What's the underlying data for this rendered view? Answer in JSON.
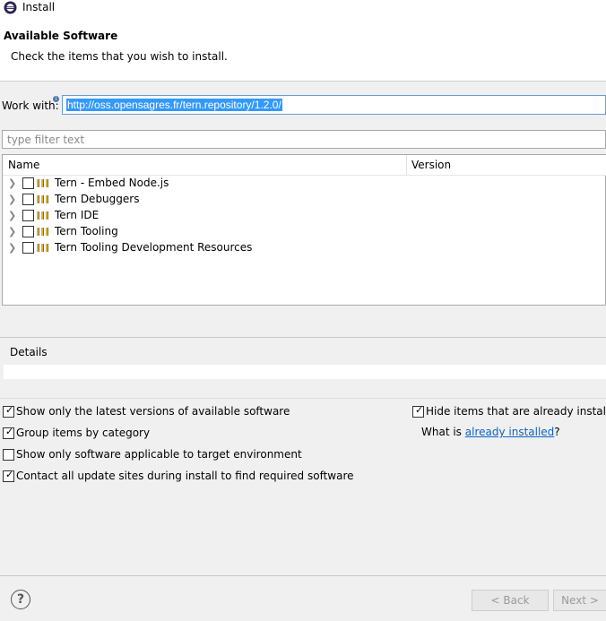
{
  "window": {
    "title": "Install",
    "icon": "eclipse-icon"
  },
  "header": {
    "title": "Available Software",
    "description": "Check the items that you wish to install."
  },
  "work_with": {
    "label": "Work with:",
    "value": "http://oss.opensagres.fr/tern.repository/1.2.0/",
    "info_icon": "info-icon"
  },
  "filter": {
    "placeholder": "type filter text"
  },
  "tree": {
    "columns": [
      "Name",
      "Version"
    ],
    "items": [
      {
        "label": "Tern - Embed Node.js",
        "checked": false
      },
      {
        "label": "Tern Debuggers",
        "checked": false
      },
      {
        "label": "Tern IDE",
        "checked": false
      },
      {
        "label": "Tern Tooling",
        "checked": false
      },
      {
        "label": "Tern Tooling Development Resources",
        "checked": false
      }
    ]
  },
  "details": {
    "label": "Details"
  },
  "options": {
    "latest_versions": {
      "label": "Show only the latest versions of available software",
      "checked": true
    },
    "group_by_category": {
      "label": "Group items by category",
      "checked": true
    },
    "target_env": {
      "label": "Show only software applicable to target environment",
      "checked": false
    },
    "contact_sites": {
      "label": "Contact all update sites during install to find required software",
      "checked": true
    },
    "hide_installed": {
      "label": "Hide items that are already installed",
      "checked": true
    },
    "what_is_prefix": "What is ",
    "what_is_link": "already installed",
    "what_is_suffix": "?"
  },
  "buttons": {
    "back": "< Back",
    "next": "Next >"
  },
  "colors": {
    "accent": "#3399ff",
    "link": "#0c64c8",
    "background": "#f0f0f0"
  }
}
